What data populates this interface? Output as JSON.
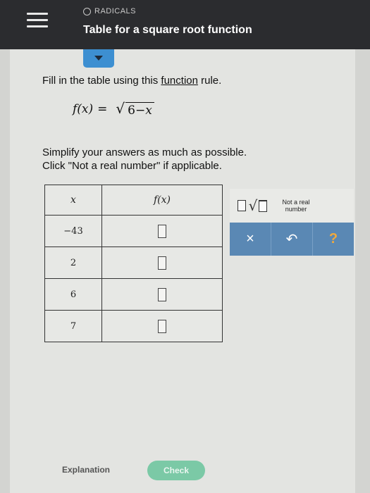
{
  "header": {
    "topic": "RADICALS",
    "title": "Table for a square root function"
  },
  "problem": {
    "instruction_prefix": "Fill in the table using this ",
    "instruction_link": "function",
    "instruction_suffix": " rule.",
    "formula_lhs": "f(x)",
    "formula_eq": "=",
    "formula_radicand_num": "6",
    "formula_radicand_op": "−",
    "formula_radicand_var": "x",
    "simplify_line1": "Simplify your answers as much as possible.",
    "simplify_line2": "Click \"Not a real number\" if applicable."
  },
  "table": {
    "header_x": "x",
    "header_fx": "f(x)",
    "rows": [
      {
        "x": "−43"
      },
      {
        "x": "2"
      },
      {
        "x": "6"
      },
      {
        "x": "7"
      }
    ]
  },
  "keypad": {
    "not_real_line1": "Not a real",
    "not_real_line2": "number",
    "clear_symbol": "×",
    "undo_symbol": "↶",
    "help_symbol": "?"
  },
  "footer": {
    "explanation": "Explanation",
    "check": "Check"
  },
  "colors": {
    "header_bg": "#2b2c2f",
    "accent_blue": "#3d8fd1",
    "keypad_blue": "#5a88b4",
    "check_green": "#7bc9a6",
    "help_orange": "#f2a93b"
  }
}
